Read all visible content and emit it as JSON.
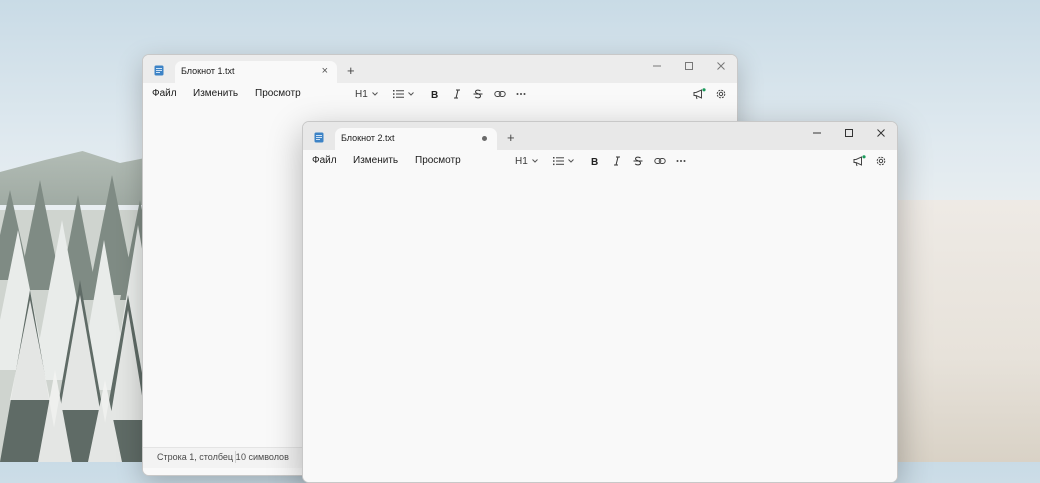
{
  "windows": [
    {
      "tab_title": "Блокнот 1.txt",
      "menu": [
        "Файл",
        "Изменить",
        "Просмотр"
      ],
      "heading_label": "H1",
      "status": {
        "position": "Строка 1, столбец 1",
        "chars": "0 символов"
      }
    },
    {
      "tab_title": "Блокнот 2.txt",
      "menu": [
        "Файл",
        "Изменить",
        "Просмотр"
      ],
      "heading_label": "H1"
    }
  ],
  "new_tab_glyph": "+",
  "close_glyph": "×",
  "colors": {
    "notify_dot": "#1a9b5b",
    "app_icon": "#3d83c6"
  },
  "icons": [
    "notepad-icon",
    "minimize-icon",
    "maximize-icon",
    "close-icon",
    "list-icon",
    "bold-icon",
    "italic-icon",
    "strikethrough-icon",
    "link-icon",
    "more-icon",
    "megaphone-icon",
    "gear-icon"
  ]
}
